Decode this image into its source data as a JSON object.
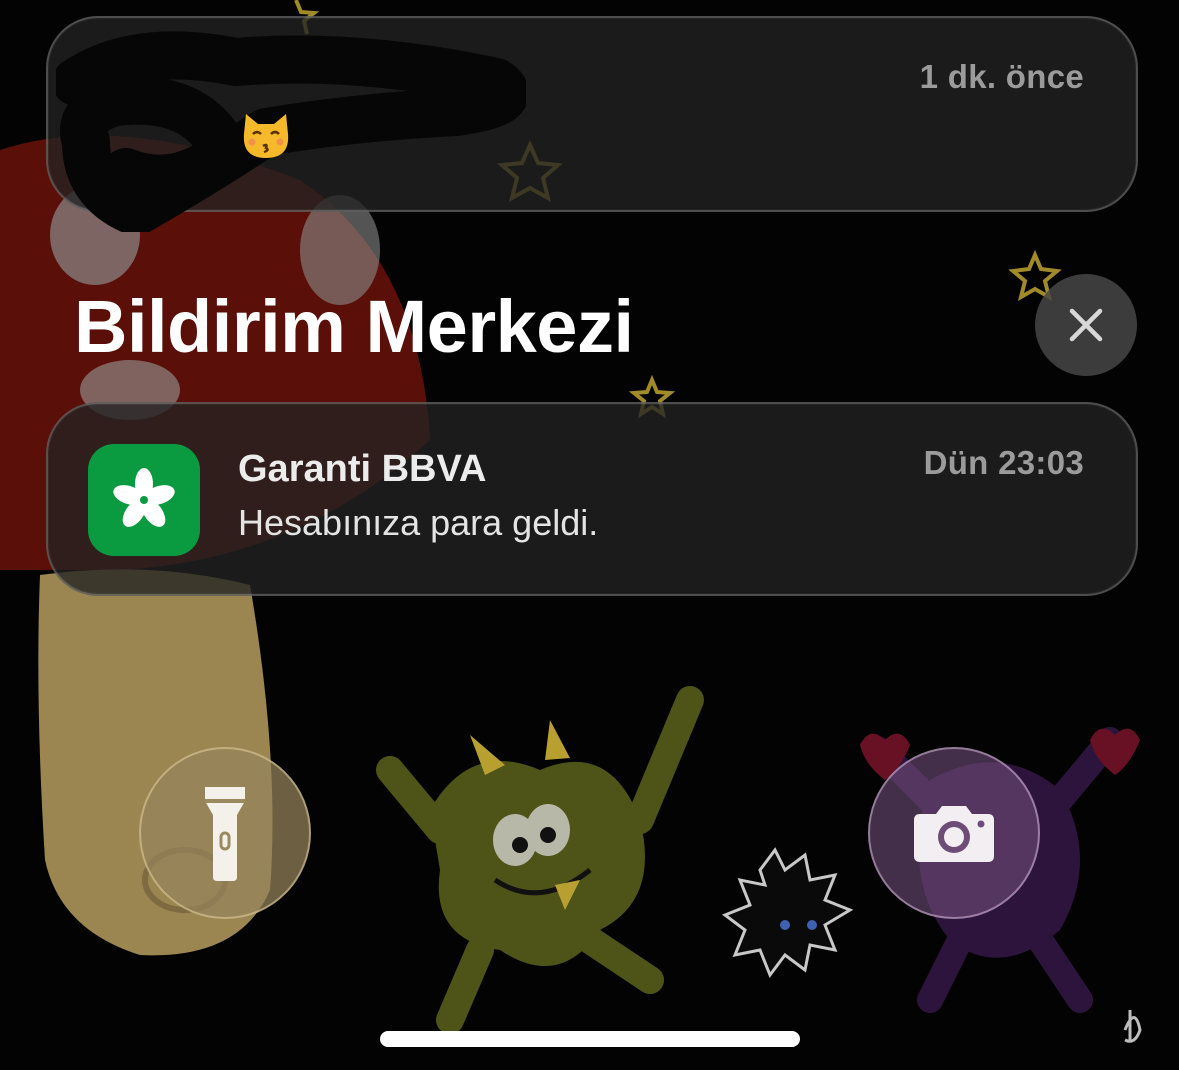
{
  "notifications": {
    "top": {
      "time": "1 dk. önce",
      "icon": "kissing-cat-emoji-icon"
    },
    "main": {
      "app_name": "Garanti BBVA",
      "message": "Hesabınıza para geldi.",
      "time": "Dün 23:03",
      "icon": "garanti-clover-icon",
      "icon_color": "#0a9a3f"
    }
  },
  "header": {
    "title": "Bildirim Merkezi",
    "close_icon": "close-icon"
  },
  "controls": {
    "flashlight_icon": "flashlight-icon",
    "camera_icon": "camera-icon"
  }
}
